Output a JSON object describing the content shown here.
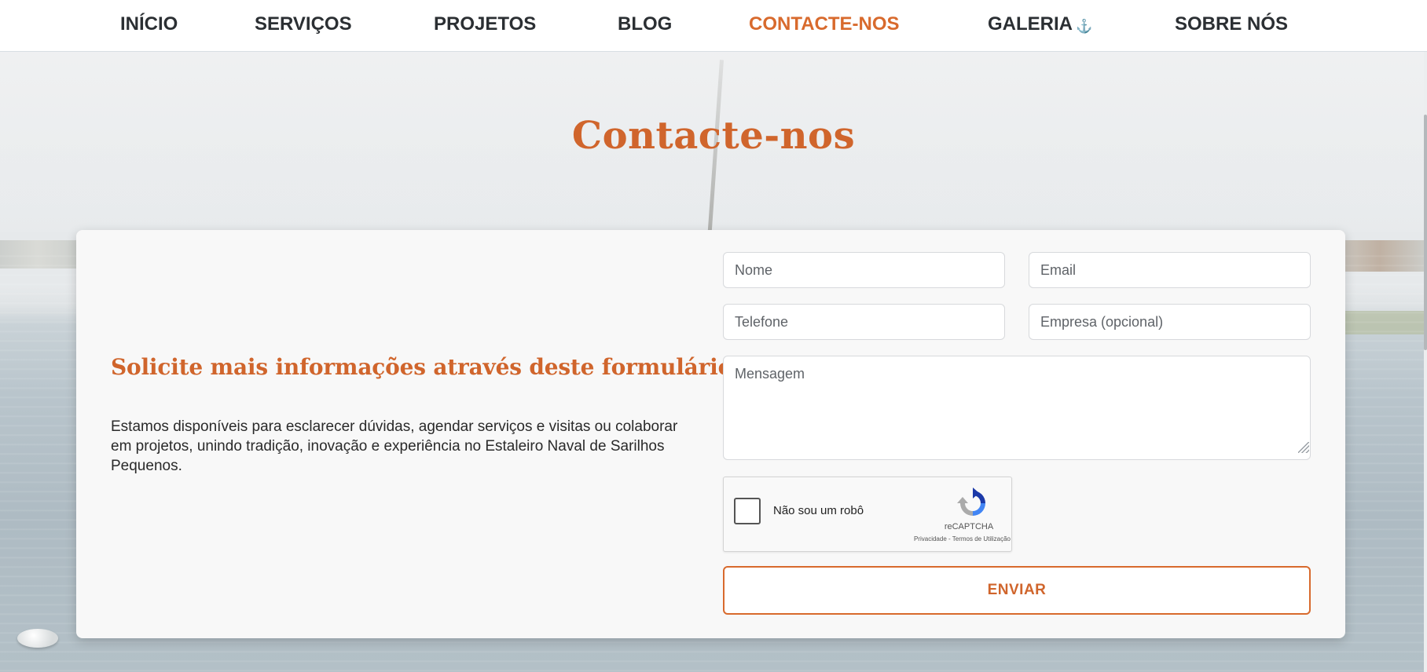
{
  "nav": {
    "items": [
      {
        "label": "INÍCIO"
      },
      {
        "label": "SERVIÇOS"
      },
      {
        "label": "PROJETOS"
      },
      {
        "label": "BLOG"
      },
      {
        "label": "CONTACTE-NOS",
        "active": true
      },
      {
        "label": "GALERIA",
        "icon": "anchor-icon",
        "icon_glyph": "⚓"
      },
      {
        "label": "SOBRE NÓS"
      }
    ]
  },
  "page": {
    "title": "Contacte-nos"
  },
  "intro": {
    "heading": "Solicite mais informações através deste formulário.",
    "text": "Estamos disponíveis para esclarecer dúvidas, agendar serviços e visitas ou colaborar em projetos, unindo tradição, inovação e experiência no Estaleiro Naval de Sarilhos Pequenos."
  },
  "form": {
    "name_placeholder": "Nome",
    "email_placeholder": "Email",
    "phone_placeholder": "Telefone",
    "company_placeholder": "Empresa (opcional)",
    "message_placeholder": "Mensagem",
    "captcha": {
      "label": "Não sou um robô",
      "brand": "reCAPTCHA",
      "privacy": "Privacidade",
      "separator": " - ",
      "terms": "Termos de Utilização",
      "checked": false
    },
    "submit_label": "ENVIAR"
  },
  "colors": {
    "accent": "#d0652c",
    "nav_text": "#2b2f33",
    "anchor": "#5f9fd6"
  }
}
